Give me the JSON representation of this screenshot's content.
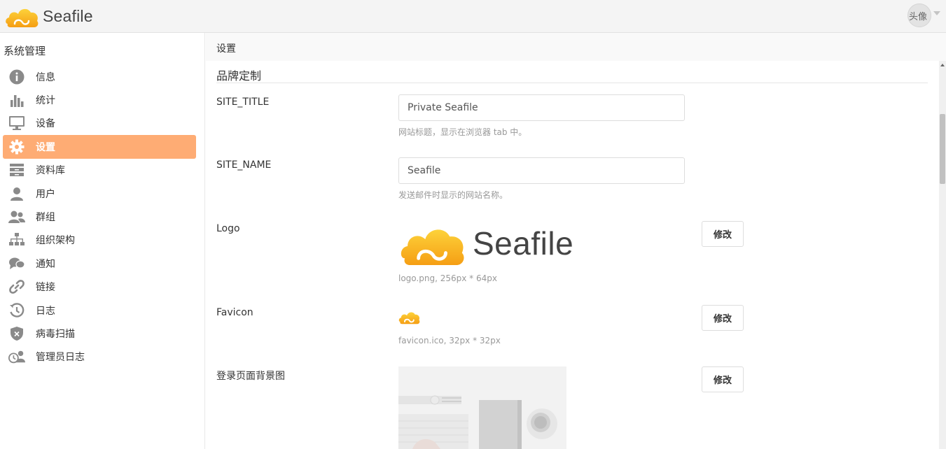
{
  "header": {
    "brand_text": "Seafile",
    "avatar_alt": "头像"
  },
  "sidebar": {
    "heading": "系统管理",
    "items": [
      {
        "label": "信息",
        "icon": "info-icon"
      },
      {
        "label": "统计",
        "icon": "bar-chart-icon"
      },
      {
        "label": "设备",
        "icon": "monitor-icon"
      },
      {
        "label": "设置",
        "icon": "gear-icon",
        "active": true
      },
      {
        "label": "资料库",
        "icon": "library-icon"
      },
      {
        "label": "用户",
        "icon": "user-icon"
      },
      {
        "label": "群组",
        "icon": "group-icon"
      },
      {
        "label": "组织架构",
        "icon": "org-chart-icon"
      },
      {
        "label": "通知",
        "icon": "notification-icon"
      },
      {
        "label": "链接",
        "icon": "link-icon"
      },
      {
        "label": "日志",
        "icon": "history-icon"
      },
      {
        "label": "病毒扫描",
        "icon": "virus-shield-icon"
      },
      {
        "label": "管理员日志",
        "icon": "admin-log-icon"
      }
    ]
  },
  "main": {
    "page_title": "设置",
    "section_title": "品牌定制",
    "site_title": {
      "label": "SITE_TITLE",
      "value": "Private Seafile",
      "help": "网站标题，显示在浏览器 tab 中。"
    },
    "site_name": {
      "label": "SITE_NAME",
      "value": "Seafile",
      "help": "发送邮件时显示的网站名称。"
    },
    "logo": {
      "label": "Logo",
      "preview_text": "Seafile",
      "info": "logo.png, 256px * 64px",
      "button": "修改"
    },
    "favicon": {
      "label": "Favicon",
      "info": "favicon.ico, 32px * 32px",
      "button": "修改"
    },
    "login_bg": {
      "label": "登录页面背景图",
      "button": "修改"
    }
  },
  "colors": {
    "accent": "#feac74",
    "brand_orange": "#f7a51c",
    "brand_yellow": "#fcc933"
  }
}
